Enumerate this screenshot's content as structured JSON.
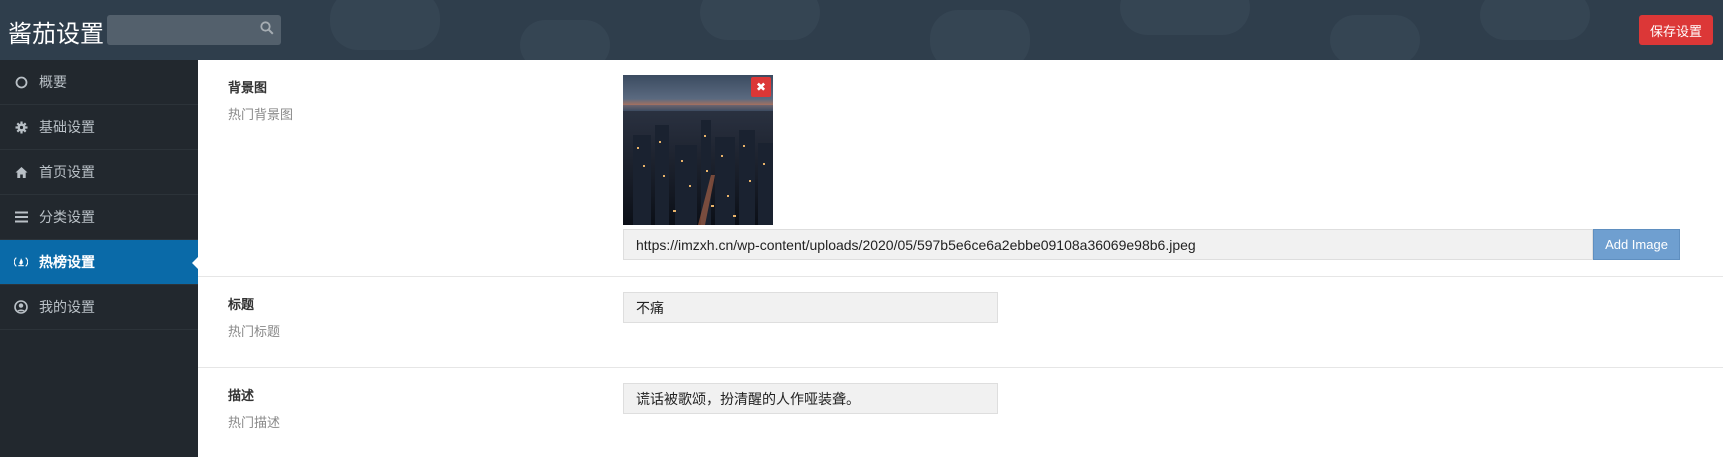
{
  "header": {
    "title": "酱茄设置",
    "search": {
      "value": "",
      "placeholder": ""
    },
    "save_label": "保存设置"
  },
  "sidebar": {
    "items": [
      {
        "label": "概要",
        "icon": "circle-icon"
      },
      {
        "label": "基础设置",
        "icon": "gear-icon"
      },
      {
        "label": "首页设置",
        "icon": "home-icon"
      },
      {
        "label": "分类设置",
        "icon": "list-icon"
      },
      {
        "label": "热榜设置",
        "icon": "fire-icon",
        "active": true
      },
      {
        "label": "我的设置",
        "icon": "user-circle-icon"
      }
    ]
  },
  "main": {
    "background": {
      "label": "背景图",
      "sub": "热门背景图",
      "url": "https://imzxh.cn/wp-content/uploads/2020/05/597b5e6ce6a2ebbe09108a36069e98b6.jpeg",
      "add_label": "Add Image",
      "remove_label": "✖"
    },
    "title_row": {
      "label": "标题",
      "sub": "热门标题",
      "value": "不痛"
    },
    "desc_row": {
      "label": "描述",
      "sub": "热门描述",
      "value": "谎话被歌颂，扮清醒的人作哑装聋。"
    }
  },
  "colors": {
    "header": "#2f3e4c",
    "sidebar": "#22282e",
    "active": "#0a6aa8",
    "danger": "#dc3737",
    "button": "#6f9fd0"
  }
}
